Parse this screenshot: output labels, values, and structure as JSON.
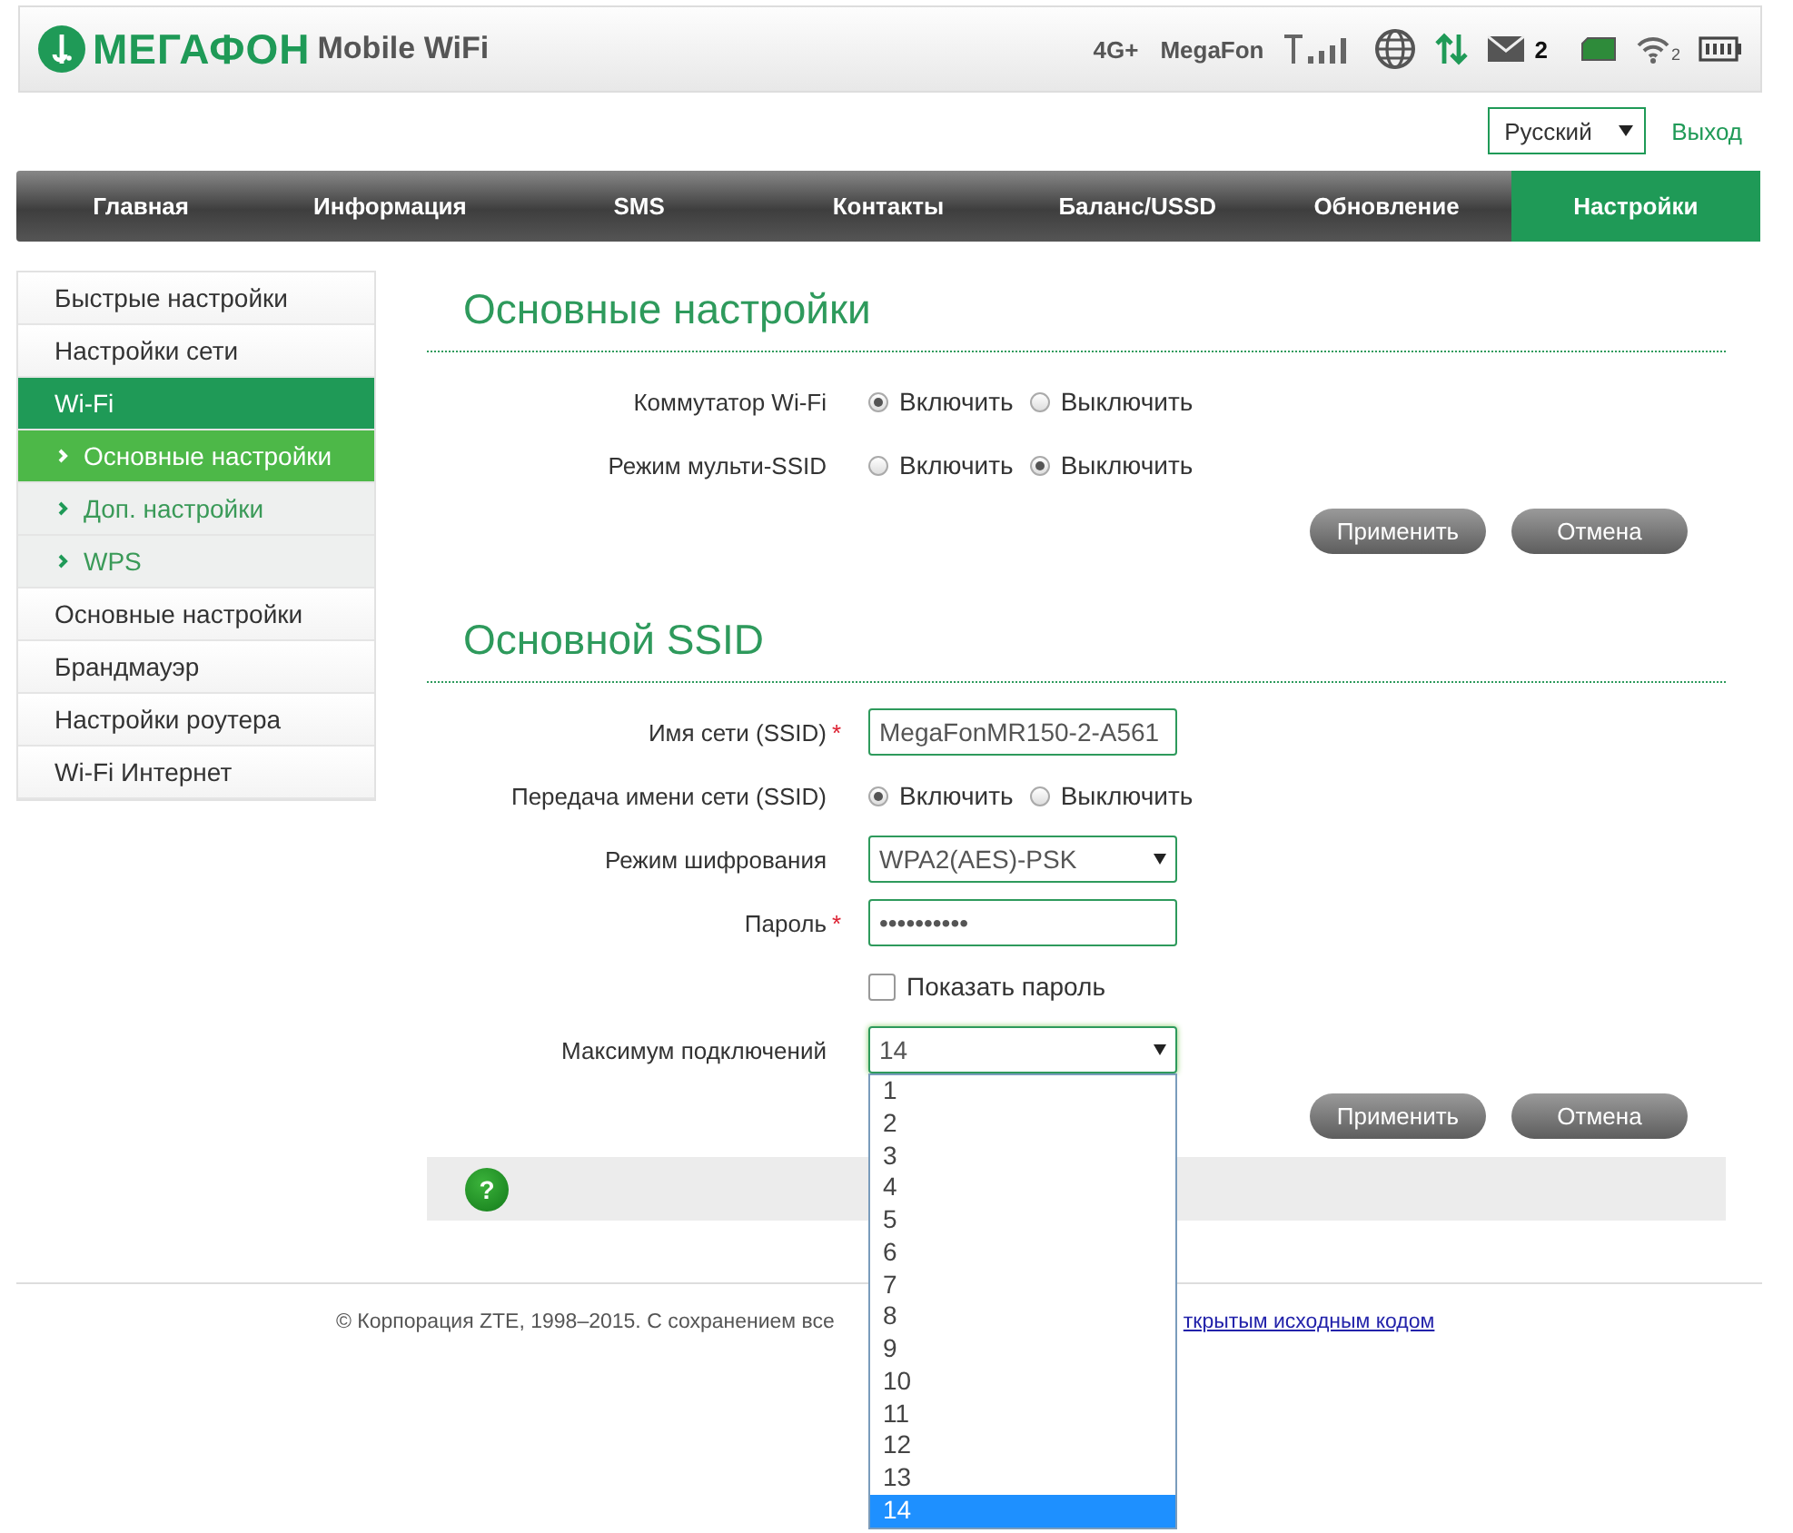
{
  "header": {
    "brand": "МЕГАФОН",
    "product": "Mobile WiFi",
    "network": "4G+",
    "operator": "MegaFon",
    "messages": "2",
    "wifi_clients": "2"
  },
  "language": {
    "value": "Русский"
  },
  "logout": "Выход",
  "nav": [
    {
      "label": "Главная",
      "selected": false
    },
    {
      "label": "Информация",
      "selected": false
    },
    {
      "label": "SMS",
      "selected": false
    },
    {
      "label": "Контакты",
      "selected": false
    },
    {
      "label": "Баланс/USSD",
      "selected": false
    },
    {
      "label": "Обновление",
      "selected": false
    },
    {
      "label": "Настройки",
      "selected": true
    }
  ],
  "sidebar": [
    {
      "label": "Быстрые настройки",
      "selected": false
    },
    {
      "label": "Настройки сети",
      "selected": false
    },
    {
      "label": "Wi-Fi",
      "selected": true,
      "children": [
        {
          "label": "Основные настройки",
          "selected": true
        },
        {
          "label": "Доп. настройки",
          "selected": false
        },
        {
          "label": "WPS",
          "selected": false
        }
      ]
    },
    {
      "label": "Основные настройки",
      "selected": false
    },
    {
      "label": "Брандмауэр",
      "selected": false
    },
    {
      "label": "Настройки роутера",
      "selected": false
    },
    {
      "label": "Wi-Fi  Интернет",
      "selected": false
    }
  ],
  "sections": [
    {
      "title": "Основные настройки",
      "rows": [
        {
          "kind": "radio",
          "label": "Коммутатор Wi-Fi",
          "options": [
            {
              "label": "Включить",
              "selected": true
            },
            {
              "label": "Выключить",
              "selected": false
            }
          ]
        },
        {
          "kind": "radio",
          "label": "Режим мульти-SSID",
          "options": [
            {
              "label": "Включить",
              "selected": false
            },
            {
              "label": "Выключить",
              "selected": true
            }
          ]
        }
      ],
      "buttons": [
        "Применить",
        "Отмена"
      ]
    },
    {
      "title": "Основной SSID",
      "rows": [
        {
          "kind": "text",
          "label": "Имя сети (SSID)",
          "required_mark": "*",
          "value": "MegaFonMR150-2-A561"
        },
        {
          "kind": "radio",
          "label": "Передача имени сети (SSID)",
          "options": [
            {
              "label": "Включить",
              "selected": true
            },
            {
              "label": "Выключить",
              "selected": false
            }
          ]
        },
        {
          "kind": "select",
          "label": "Режим шифрования",
          "value": "WPA2(AES)-PSK",
          "expanded": false
        },
        {
          "kind": "text",
          "label": "Пароль",
          "required_mark": "*",
          "value": "••••••••••"
        },
        {
          "kind": "checkbox",
          "label": "Показать пароль",
          "checked": false
        },
        {
          "kind": "select",
          "label": "Максимум подключений",
          "value": "14",
          "expanded": true,
          "options": [
            {
              "label": "1",
              "selected": false
            },
            {
              "label": "2",
              "selected": false
            },
            {
              "label": "3",
              "selected": false
            },
            {
              "label": "4",
              "selected": false
            },
            {
              "label": "5",
              "selected": false
            },
            {
              "label": "6",
              "selected": false
            },
            {
              "label": "7",
              "selected": false
            },
            {
              "label": "8",
              "selected": false
            },
            {
              "label": "9",
              "selected": false
            },
            {
              "label": "10",
              "selected": false
            },
            {
              "label": "11",
              "selected": false
            },
            {
              "label": "12",
              "selected": false
            },
            {
              "label": "13",
              "selected": false
            },
            {
              "label": "14",
              "selected": true
            }
          ]
        }
      ],
      "buttons": [
        "Применить",
        "Отмена"
      ]
    }
  ],
  "help": {
    "label": "?"
  },
  "footer": {
    "text": "© Корпорация ZTE, 1998–2015. С сохранением все",
    "link": "ткрытым исходным кодом"
  }
}
